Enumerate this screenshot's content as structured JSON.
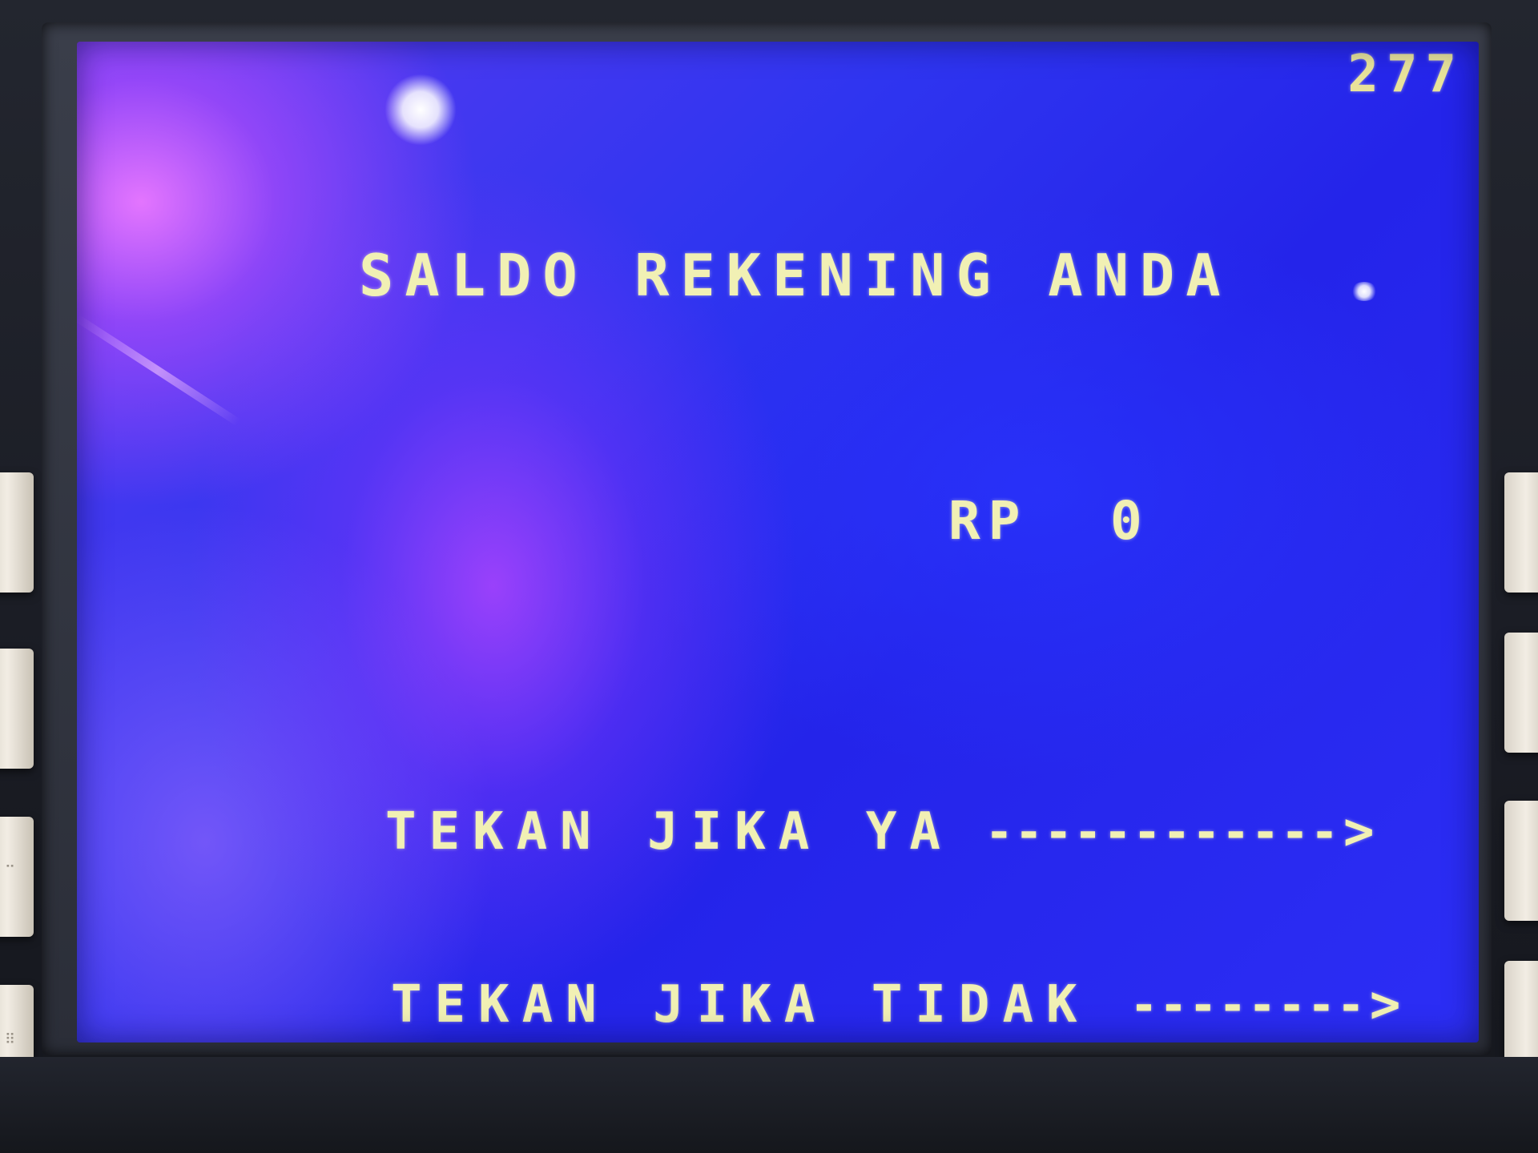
{
  "screen": {
    "code": "277",
    "title": "SALDO REKENING ANDA",
    "balance": {
      "currency": "RP",
      "amount": "0"
    },
    "options": [
      {
        "label": "TEKAN JIKA YA",
        "leader": "------------",
        "arrow": ">"
      },
      {
        "label": "TEKAN JIKA TIDAK",
        "leader": "--------",
        "arrow": ">"
      }
    ]
  },
  "colors": {
    "screen_background": "#2424ea",
    "text": "#f1f0b4",
    "bezel": "#2b2e38",
    "key": "#f2ede4"
  }
}
